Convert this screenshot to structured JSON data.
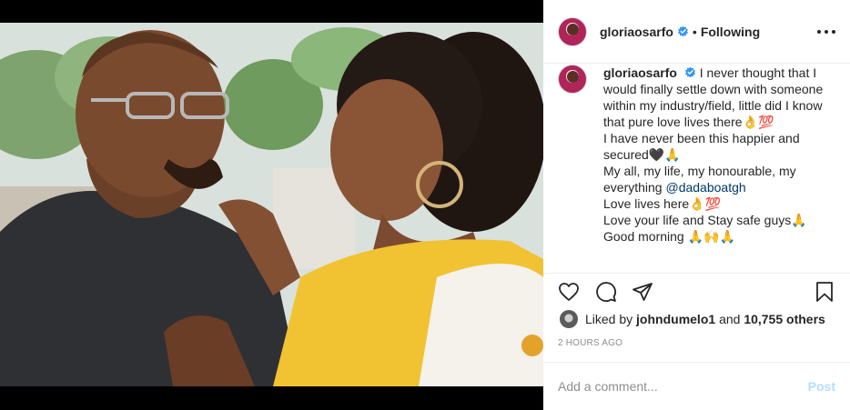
{
  "post": {
    "username": "gloriaosarfo",
    "follow_state": "Following",
    "separator": "•"
  },
  "caption": {
    "username": "gloriaosarfo",
    "lines": [
      "I never thought that I would finally settle down with someone within my industry/field, little did I know that pure love lives there👌💯",
      "I have never been this happier and secured🖤🙏",
      "My all, my life, my honourable, my everything",
      "Love lives here👌💯",
      "Love your life and Stay safe guys🙏",
      "Good morning 🙏🙌🙏"
    ],
    "mention": "@dadaboatgh"
  },
  "likes": {
    "prefix": "Liked by",
    "liker": "johndumelo1",
    "and": "and",
    "others": "10,755 others"
  },
  "timestamp": "2 HOURS AGO",
  "comment": {
    "placeholder": "Add a comment...",
    "post_label": "Post"
  },
  "colors": {
    "verified_blue": "#3897f0",
    "text": "#262626",
    "muted": "#8e8e8e",
    "post_disabled": "#b2dffc",
    "mention": "#00376b"
  },
  "icons": [
    "heart-icon",
    "comment-icon",
    "share-icon",
    "bookmark-icon",
    "more-icon",
    "verified-badge-icon"
  ]
}
